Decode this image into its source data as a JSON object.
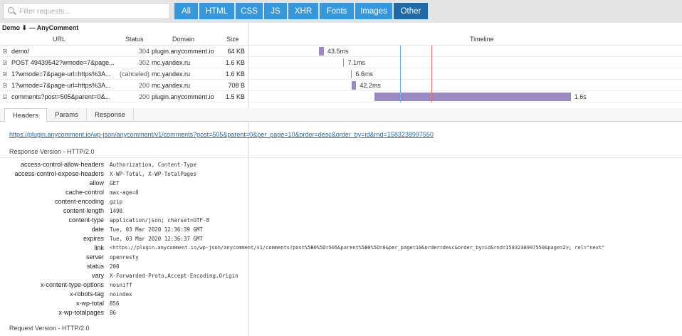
{
  "toolbar": {
    "search_placeholder": "Filter requests...",
    "filters": [
      "All",
      "HTML",
      "CSS",
      "JS",
      "XHR",
      "Fonts",
      "Images",
      "Other"
    ],
    "active_filter": "Other"
  },
  "page_title": "Demo ⬇ — AnyComment",
  "columns": {
    "url": "URL",
    "status": "Status",
    "domain": "Domain",
    "size": "Size",
    "timeline": "Timeline"
  },
  "requests": [
    {
      "url": "demo/",
      "status": "304",
      "domain": "plugin.anycomment.io",
      "size": "64 KB",
      "time": "43.5ms",
      "expanded": false,
      "start": 0.16,
      "duration": 0.012
    },
    {
      "url": "POST 49439542?wmode=7&page...",
      "status": "302",
      "domain": "mc.yandex.ru",
      "size": "1.6 KB",
      "time": "7.1ms",
      "expanded": false,
      "start": 0.217,
      "duration": 0.002
    },
    {
      "url": "1?wmode=7&page-url=https%3A...",
      "status": "(canceled)",
      "domain": "mc.yandex.ru",
      "size": "1.6 KB",
      "time": "6.6ms",
      "expanded": false,
      "start": 0.235,
      "duration": 0.002
    },
    {
      "url": "1?wmode=7&page-url=https%3A...",
      "status": "200",
      "domain": "mc.yandex.ru",
      "size": "708 B",
      "time": "42.2ms",
      "expanded": false,
      "start": 0.236,
      "duration": 0.011
    },
    {
      "url": "comments?post=505&parent=0&...",
      "status": "200",
      "domain": "plugin.anycomment.io",
      "size": "1.5 KB",
      "time": "1.6s",
      "expanded": true,
      "start": 0.289,
      "duration": 0.456
    }
  ],
  "colors": {
    "accent": "#3598dc",
    "accent_active": "#1d6aa7",
    "bar": "#9b89c4",
    "dom_content_line": "#6aaee8",
    "load_line": "#e6786d"
  },
  "detail": {
    "tabs": [
      "Headers",
      "Params",
      "Response"
    ],
    "active_tab": "Headers",
    "url": "https://plugin.anycomment.io/wp-json/anycomment/v1/comments?post=505&parent=0&per_page=10&order=desc&order_by=id&rnd=1583238997550",
    "response_section": "Response Version - HTTP/2.0",
    "request_section": "Request Version - HTTP/2.0",
    "headers": [
      {
        "name": "access-control-allow-headers",
        "value": "Authorization, Content-Type"
      },
      {
        "name": "access-control-expose-headers",
        "value": "X-WP-Total, X-WP-TotalPages"
      },
      {
        "name": "allow",
        "value": "GET"
      },
      {
        "name": "cache-control",
        "value": "max-age=0"
      },
      {
        "name": "content-encoding",
        "value": "gzip"
      },
      {
        "name": "content-length",
        "value": "1490"
      },
      {
        "name": "content-type",
        "value": "application/json; charset=UTF-8"
      },
      {
        "name": "date",
        "value": "Tue, 03 Mar 2020 12:36:39 GMT"
      },
      {
        "name": "expires",
        "value": "Tue, 03 Mar 2020 12:36:37 GMT"
      },
      {
        "name": "link",
        "value": "<https://plugin.anycomment.io/wp-json/anycomment/v1/comments?post%5B0%5D=505&parent%5B0%5D=0&per_page=10&order=desc&order_by=id&rnd=1583238997550&page=2>; rel=\"next\""
      },
      {
        "name": "server",
        "value": "openresty"
      },
      {
        "name": "status",
        "value": "200"
      },
      {
        "name": "vary",
        "value": "X-Forwarded-Proto,Accept-Encoding,Origin"
      },
      {
        "name": "x-content-type-options",
        "value": "nosniff"
      },
      {
        "name": "x-robots-tag",
        "value": "noindex"
      },
      {
        "name": "x-wp-total",
        "value": "856"
      },
      {
        "name": "x-wp-totalpages",
        "value": "86"
      }
    ]
  }
}
